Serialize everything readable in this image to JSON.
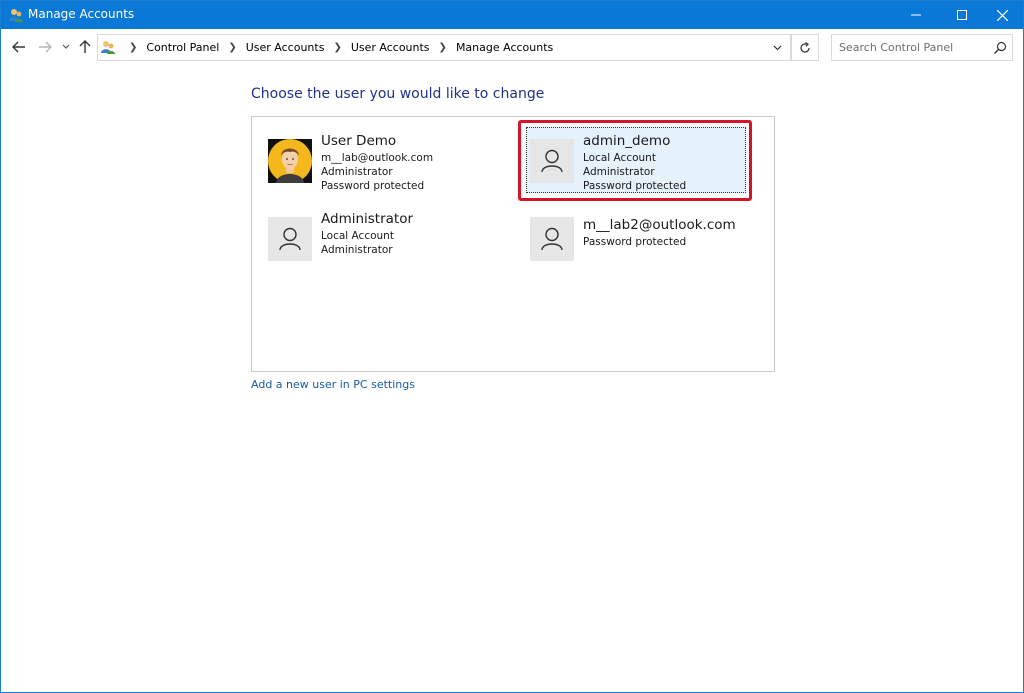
{
  "window": {
    "title": "Manage Accounts",
    "titlebar_color": "#0a78d7"
  },
  "navigation": {
    "back_icon": "arrow-left-icon",
    "forward_icon": "arrow-right-icon",
    "recent_icon": "chevron-down-icon",
    "up_icon": "arrow-up-icon"
  },
  "address": {
    "crumbs": [
      "Control Panel",
      "User Accounts",
      "User Accounts",
      "Manage Accounts"
    ]
  },
  "search": {
    "placeholder": "Search Control Panel"
  },
  "main": {
    "heading": "Choose the user you would like to change",
    "add_user_link": "Add a new user in PC settings",
    "accounts": [
      {
        "name": "User Demo",
        "lines": [
          "m__lab@outlook.com",
          "Administrator",
          "Password protected"
        ],
        "avatar": "photo"
      },
      {
        "name": "admin_demo",
        "lines": [
          "Local Account",
          "Administrator",
          "Password protected"
        ],
        "avatar": "generic",
        "selected": true
      },
      {
        "name": "Administrator",
        "lines": [
          "Local Account",
          "Administrator"
        ],
        "avatar": "generic"
      },
      {
        "name": "m__lab2@outlook.com",
        "lines": [
          "Password protected"
        ],
        "avatar": "generic"
      }
    ]
  },
  "colors": {
    "heading": "#1e3287",
    "link": "#1a5aa8",
    "selection_fill": "#e5f1fb",
    "highlight_border": "#d3142a"
  }
}
